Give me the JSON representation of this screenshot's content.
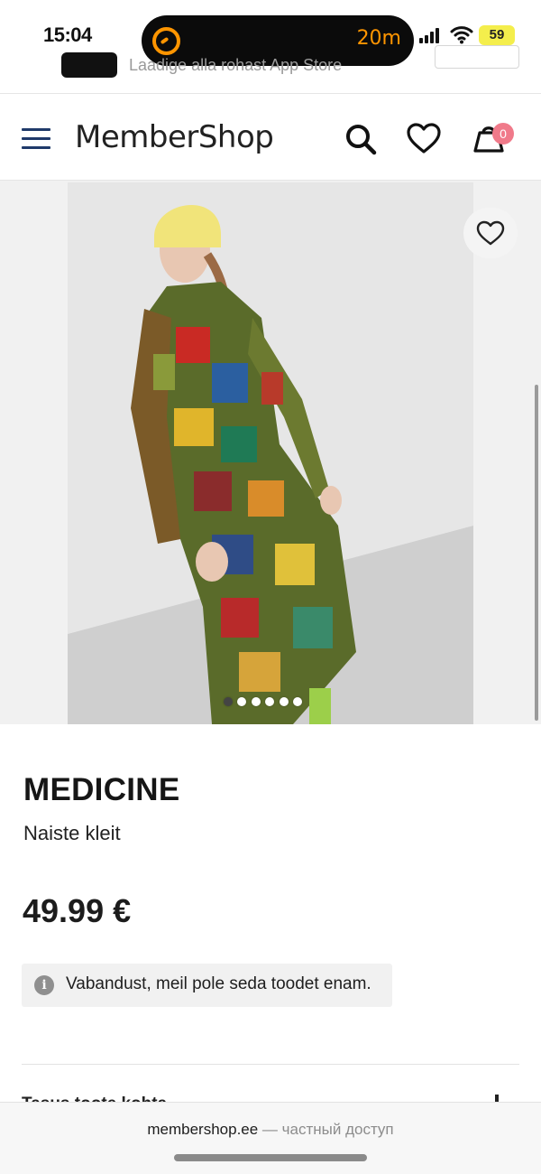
{
  "status_bar": {
    "time": "15:04",
    "island_timer": "20m",
    "battery": "59"
  },
  "app_banner": {
    "text": "Laadige alla rohast App Store"
  },
  "header": {
    "logo": "MemberShop",
    "cart_count": "0"
  },
  "product": {
    "brand": "MEDICINE",
    "subtitle": "Naiste kleit",
    "price": "49.99 €",
    "unavailable_notice": "Vabandust, meil pole seda toodet enam.",
    "next_section_heading": "Tasus toote kohta",
    "gallery_dots_count": 6,
    "gallery_active_index": 0
  },
  "browser": {
    "domain": "membershop.ee",
    "suffix": " — частный доступ"
  },
  "colors": {
    "accent_orange": "#ff9500",
    "hamburger_blue": "#1f3a6a",
    "cart_badge": "#f07a8a",
    "battery_yellow": "#f4ee4c"
  }
}
